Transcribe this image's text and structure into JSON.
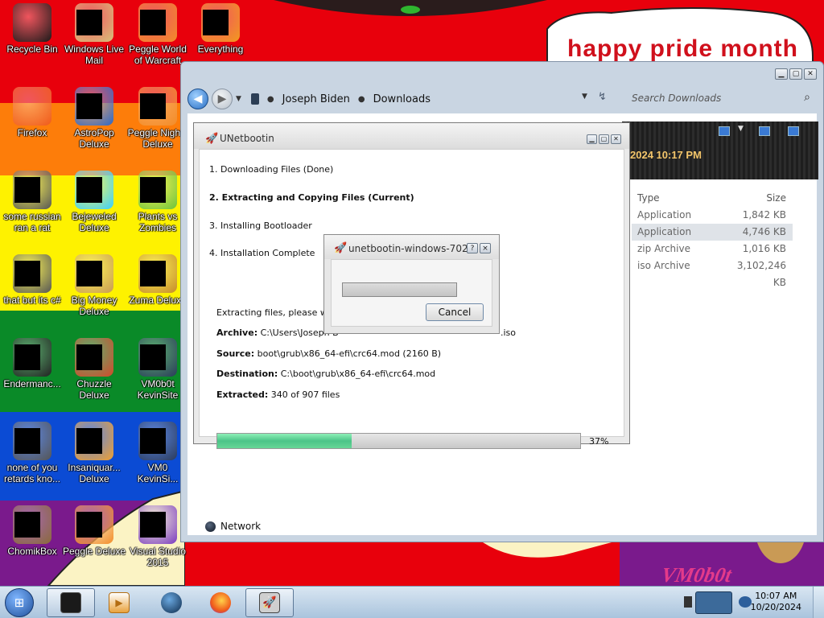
{
  "wallpaper": {
    "greeting": "happy pride month",
    "signature": "VM0b0t"
  },
  "desktop_icons": [
    {
      "label": "Recycle Bin",
      "icon": "recycle-bin-icon"
    },
    {
      "label": "Windows Live\nMail",
      "icon": "mail-icon"
    },
    {
      "label": "Peggle World\nof Warcraft",
      "icon": "peggle-icon"
    },
    {
      "label": "Everything",
      "icon": "search-app-icon"
    },
    {
      "label": "Firefox",
      "icon": "firefox-icon"
    },
    {
      "label": "AstroPop\nDeluxe",
      "icon": "game-icon"
    },
    {
      "label": "Peggle Nights\nDeluxe",
      "icon": "peggle-icon"
    },
    {
      "label": "some russian\nran a rat",
      "icon": "shortcut-icon"
    },
    {
      "label": "Bejeweled\nDeluxe",
      "icon": "gem-icon"
    },
    {
      "label": "Plants vs\nZombies",
      "icon": "plant-icon"
    },
    {
      "label": "that but its c#",
      "icon": "shortcut-icon"
    },
    {
      "label": "Big Money\nDeluxe",
      "icon": "money-bag-icon"
    },
    {
      "label": "Zuma Deluxe",
      "icon": "frog-icon"
    },
    {
      "label": "Endermanc...",
      "icon": "terminal-icon"
    },
    {
      "label": "Chuzzle\nDeluxe",
      "icon": "chuzzle-icon"
    },
    {
      "label": "VM0b0t\nKevinSite",
      "icon": "globe-icon"
    },
    {
      "label": "none of you\nretards kno...",
      "icon": "shortcut-icon"
    },
    {
      "label": "Insaniquar...\nDeluxe",
      "icon": "fish-icon"
    },
    {
      "label": "VM0\nKevinSi...",
      "icon": "globe-icon"
    },
    {
      "label": "ChomikBox",
      "icon": "hamster-icon"
    },
    {
      "label": "Peggle Deluxe",
      "icon": "peggle-icon"
    },
    {
      "label": "Visual Studio\n2015",
      "icon": "visual-studio-icon"
    }
  ],
  "explorer": {
    "breadcrumb": [
      "Joseph Biden",
      "Downloads"
    ],
    "search_placeholder": "Search Downloads",
    "banner_date": "2024 10:17 PM",
    "columns": {
      "type": "Type",
      "size": "Size"
    },
    "rows": [
      {
        "type": "Application",
        "size": "1,842 KB",
        "selected": false
      },
      {
        "type": "Application",
        "size": "4,746 KB",
        "selected": true
      },
      {
        "type": "zip Archive",
        "size": "1,016 KB",
        "selected": false
      },
      {
        "type": "iso Archive",
        "size": "3,102,246 KB",
        "selected": false
      }
    ],
    "network_label": "Network"
  },
  "unetbootin": {
    "title": "UNetbootin",
    "steps": [
      "1. Downloading Files (Done)",
      "2. Extracting and Copying Files (Current)",
      "3. Installing Bootloader",
      "4. Installation Complete"
    ],
    "current_step": 1,
    "status": "Extracting files, please wait...",
    "archive_label": "Archive:",
    "archive_value": "C:\\Users\\Joseph B",
    "archive_suffix": ".iso",
    "source_label": "Source:",
    "source_value": "boot\\grub\\x86_64-efi\\crc64.mod (2160 B)",
    "destination_label": "Destination:",
    "destination_value": "C:\\boot\\grub\\x86_64-efi\\crc64.mod",
    "extracted_label": "Extracted:",
    "extracted_value": "340 of 907 files",
    "progress": 0.37,
    "progress_text": "37%"
  },
  "dialog": {
    "title": "unetbootin-windows-702",
    "help_label": "?",
    "close_label": "×",
    "cancel_label": "Cancel",
    "progress": 0
  },
  "taskbar": {
    "time": "10:07 AM",
    "date": "10/20/2024"
  },
  "colors": {
    "stripe_red": "#e8000c",
    "stripe_orange": "#fd7d0a",
    "stripe_yellow": "#fef200",
    "stripe_green": "#0a8a28",
    "stripe_blue": "#0b4bd4",
    "stripe_purple": "#7a1a8c",
    "progress_fill": "#4cc488"
  }
}
